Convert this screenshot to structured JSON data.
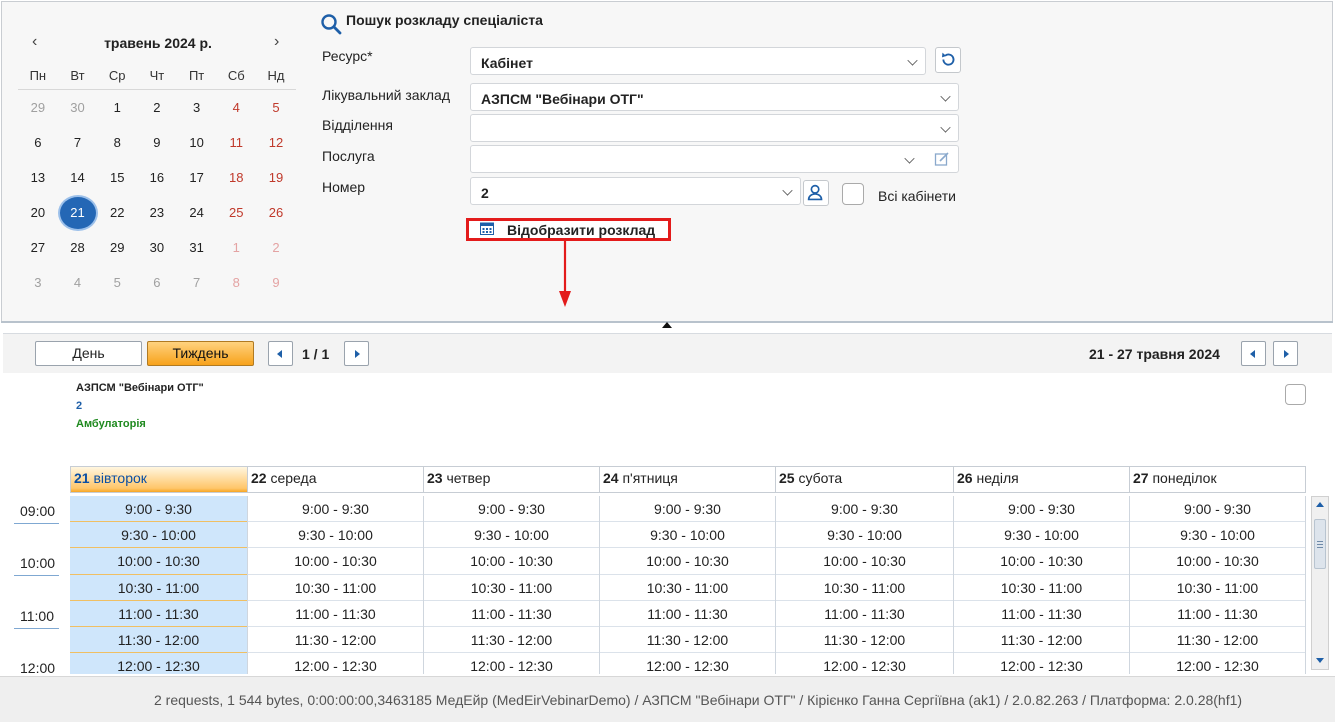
{
  "calendar": {
    "month_title": "травень 2024 р.",
    "prev": "‹",
    "next": "›",
    "weekdays": [
      "Пн",
      "Вт",
      "Ср",
      "Чт",
      "Пт",
      "Сб",
      "Нд"
    ],
    "weeks": [
      [
        "29",
        "30",
        "1",
        "2",
        "3",
        "4",
        "5"
      ],
      [
        "6",
        "7",
        "8",
        "9",
        "10",
        "11",
        "12"
      ],
      [
        "13",
        "14",
        "15",
        "16",
        "17",
        "18",
        "19"
      ],
      [
        "20",
        "21",
        "22",
        "23",
        "24",
        "25",
        "26"
      ],
      [
        "27",
        "28",
        "29",
        "30",
        "31",
        "1",
        "2"
      ],
      [
        "3",
        "4",
        "5",
        "6",
        "7",
        "8",
        "9"
      ]
    ],
    "selected_day": "21"
  },
  "search": {
    "title": "Пошук розкладу спеціаліста",
    "resource_label": "Ресурс*",
    "resource_value": "Кабінет",
    "facility_label": "Лікувальний заклад",
    "facility_value": "АЗПСМ \"Вебінари ОТГ\"",
    "department_label": "Відділення",
    "department_value": "",
    "service_label": "Послуга",
    "service_value": "",
    "number_label": "Номер",
    "number_value": "2",
    "all_cabinets_label": "Всі кабінети",
    "show_button": "Відобразити розклад"
  },
  "toolbar": {
    "day_button": "День",
    "week_button": "Тиждень",
    "page": "1 / 1",
    "range": "21 - 27 травня 2024"
  },
  "info": {
    "org": "АЗПСМ \"Вебінари ОТГ\"",
    "number": "2",
    "type": "Амбулаторія"
  },
  "schedule": {
    "days": [
      {
        "num": "21",
        "name": "вівторок"
      },
      {
        "num": "22",
        "name": "середа"
      },
      {
        "num": "23",
        "name": "четвер"
      },
      {
        "num": "24",
        "name": "п'ятниця"
      },
      {
        "num": "25",
        "name": "субота"
      },
      {
        "num": "26",
        "name": "неділя"
      },
      {
        "num": "27",
        "name": "понеділок"
      }
    ],
    "hours": [
      "09:00",
      "10:00",
      "11:00",
      "12:00"
    ],
    "slots": [
      "9:00 - 9:30",
      "9:30 - 10:00",
      "10:00 - 10:30",
      "10:30 - 11:00",
      "11:00 - 11:30",
      "11:30 - 12:00",
      "12:00 - 12:30"
    ]
  },
  "status": {
    "text": "2 requests, 1 544 bytes, 0:00:00:00,3463185  МедЕйр (MedEirVebinarDemo) / АЗПСМ \"Вебінари ОТГ\" / Кірієнко Ганна Сергіївна (ak1) / 2.0.82.263 / Платформа: 2.0.28(hf1)"
  },
  "colors": {
    "accent": "#1e5fa8",
    "selected_day": "#2467b5",
    "weekend": "#c0392b",
    "highlight_border": "#e31b1b",
    "today_column": "#cfe6fb",
    "week_button": "#f7a21b"
  }
}
